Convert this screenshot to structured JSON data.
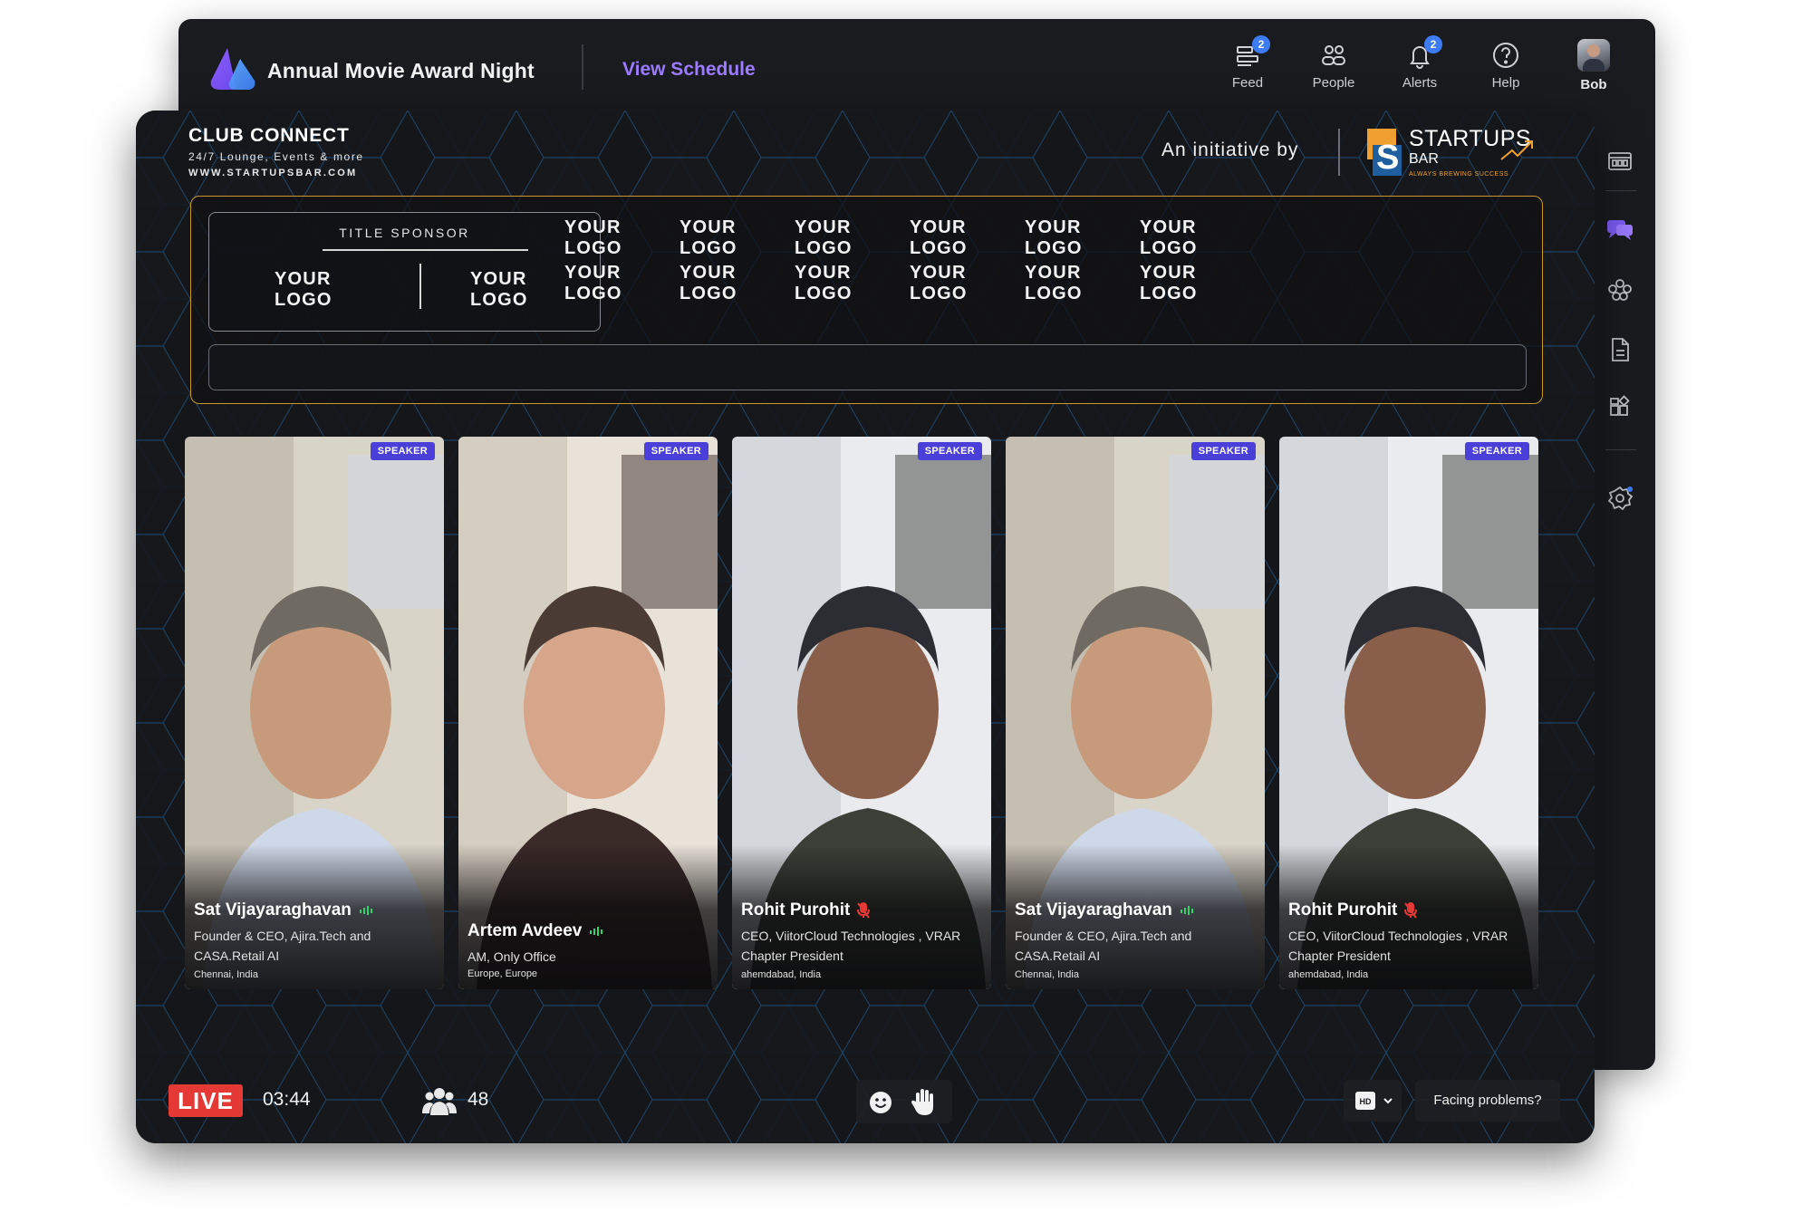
{
  "app": {
    "title": "Annual Movie Award Night",
    "view_schedule": "View Schedule",
    "accent": "#9b7bff"
  },
  "nav": [
    {
      "label": "Feed",
      "icon": "feed-icon",
      "badge": "2"
    },
    {
      "label": "People",
      "icon": "people-icon",
      "badge": ""
    },
    {
      "label": "Alerts",
      "icon": "bell-icon",
      "badge": "2"
    },
    {
      "label": "Help",
      "icon": "help-icon",
      "badge": ""
    },
    {
      "label": "Bob",
      "icon": "avatar",
      "badge": ""
    }
  ],
  "side_rail": [
    "dashboard-icon",
    "chat-icon",
    "groups-icon",
    "document-icon",
    "widgets-icon",
    "settings-icon"
  ],
  "stage": {
    "club_title": "CLUB CONNECT",
    "club_sub": "24/7 Lounge, Events & more",
    "club_url": "WWW.STARTUPSBAR.COM",
    "initiative": "An initiative by",
    "partner_name": "STARTUPS",
    "partner_bar": "BAR",
    "partner_tag": "ALWAYS BREWING SUCCESS"
  },
  "sponsors": {
    "title_label": "TITLE SPONSOR",
    "title_logos": [
      "YOUR\nLOGO",
      "YOUR\nLOGO"
    ],
    "logo_text_line1": "YOUR",
    "logo_text_line2": "LOGO",
    "grid_rows": 2,
    "grid_cols": 6
  },
  "speakers": [
    {
      "badge": "SPEAKER",
      "name": "Sat Vijayaraghavan",
      "role": "Founder & CEO, Ajira.Tech and CASA.Retail AI",
      "location": "Chennai, India",
      "mic": "on"
    },
    {
      "badge": "SPEAKER",
      "name": "Artem Avdeev",
      "role": "AM, Only Office",
      "location": "Europe, Europe",
      "mic": "on"
    },
    {
      "badge": "SPEAKER",
      "name": "Rohit Purohit",
      "role": "CEO, ViitorCloud Technologies , VRAR Chapter President",
      "location": "ahemdabad, India",
      "mic": "off"
    },
    {
      "badge": "SPEAKER",
      "name": "Sat Vijayaraghavan",
      "role": "Founder & CEO, Ajira.Tech and CASA.Retail AI",
      "location": "Chennai, India",
      "mic": "on"
    },
    {
      "badge": "SPEAKER",
      "name": "Rohit Purohit",
      "role": "CEO, ViitorCloud Technologies , VRAR Chapter President",
      "location": "ahemdabad, India",
      "mic": "off"
    }
  ],
  "bottom": {
    "live": "LIVE",
    "timer": "03:44",
    "attendees": "48",
    "hd": "HD",
    "facing": "Facing problems?",
    "live_color": "#e53935"
  }
}
